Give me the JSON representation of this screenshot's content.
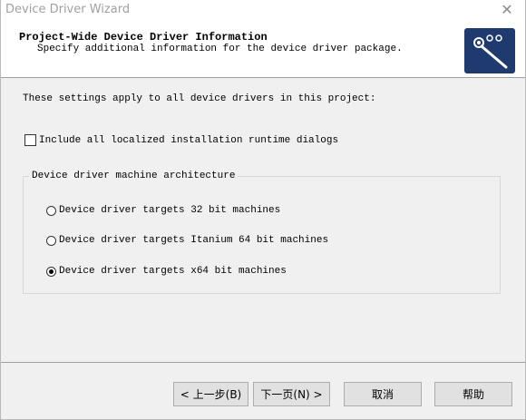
{
  "window": {
    "title": "Device Driver Wizard",
    "close_glyph": "✕"
  },
  "header": {
    "title": "Project-Wide Device Driver Information",
    "subtitle": "Specify additional information for the device driver package."
  },
  "content": {
    "intro": "These settings apply to all device drivers in this project:",
    "checkbox_label": "Include all localized installation runtime dialogs",
    "checkbox_checked": false,
    "group_label": "Device driver machine architecture",
    "radios": [
      {
        "label": "Device driver targets 32 bit machines",
        "checked": false
      },
      {
        "label": "Device driver targets Itanium 64 bit machines",
        "checked": false
      },
      {
        "label": "Device driver targets x64 bit machines",
        "checked": true
      }
    ]
  },
  "buttons": {
    "back": "< 上一步(B)",
    "next": "下一页(N) >",
    "cancel": "取消",
    "help": "帮助"
  },
  "colors": {
    "logo_bg": "#1f3a6e",
    "dialog_bg": "#f0f0f0",
    "button_bg": "#e1e1e1"
  }
}
